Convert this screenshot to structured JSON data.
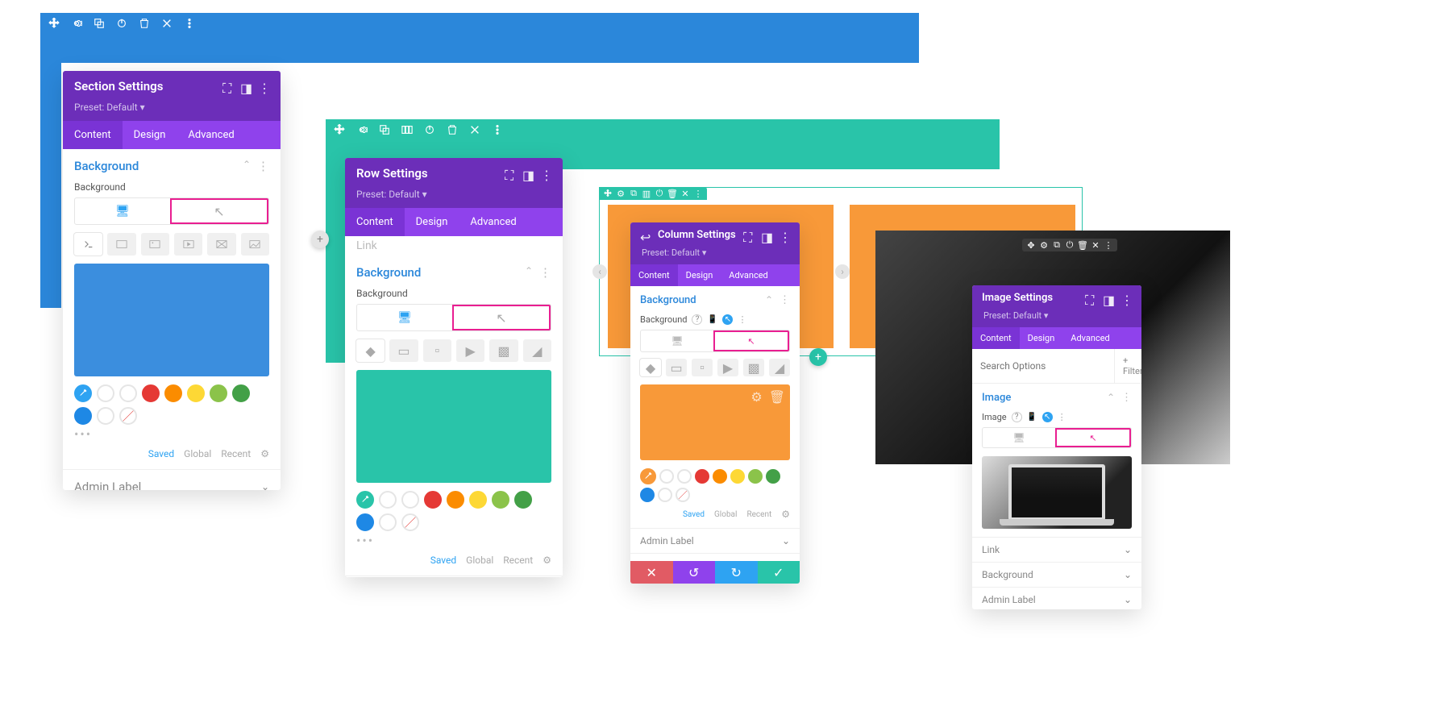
{
  "colors": {
    "blue": "#2b87da",
    "teal": "#29c4a9",
    "purple": "#6c2eb9",
    "purple_light": "#8f42ec",
    "orange": "#f89939",
    "red": "#e15b64",
    "linkblue": "#2ea3f2",
    "magenta": "#e91e91"
  },
  "modals": {
    "section": {
      "title": "Section Settings",
      "preset": "Preset: Default",
      "tabs": [
        "Content",
        "Design",
        "Advanced"
      ],
      "active_tab": "Content",
      "bg_title": "Background",
      "bg_label": "Background",
      "preview_color": "#3b8ede",
      "picker_ring": "#2ea3f2",
      "swatches": [
        "#ffffff",
        "#ffffff",
        "#e53935",
        "#fb8c00",
        "#fdd835",
        "#8bc34a",
        "#43a047",
        "#1e88e5",
        "#ffffff"
      ],
      "links": [
        "Saved",
        "Global",
        "Recent"
      ],
      "admin": "Admin Label"
    },
    "row": {
      "title": "Row Settings",
      "preset": "Preset: Default",
      "tabs": [
        "Content",
        "Design",
        "Advanced"
      ],
      "active_tab": "Content",
      "link_title": "Link",
      "bg_title": "Background",
      "bg_label": "Background",
      "preview_color": "#29c4a9",
      "picker_ring": "#29c4a9",
      "swatches": [
        "#ffffff",
        "#ffffff",
        "#e53935",
        "#fb8c00",
        "#fdd835",
        "#8bc34a",
        "#43a047",
        "#1e88e5",
        "#ffffff"
      ],
      "links": [
        "Saved",
        "Global",
        "Recent"
      ],
      "admin": "Admin Label"
    },
    "column": {
      "title": "Column Settings",
      "preset": "Preset: Default",
      "tabs": [
        "Content",
        "Design",
        "Advanced"
      ],
      "active_tab": "Content",
      "bg_title": "Background",
      "bg_label": "Background",
      "bg_help": "?",
      "preview_color": "#f89939",
      "picker_ring": "#f89939",
      "swatches": [
        "#ffffff",
        "#ffffff",
        "#e53935",
        "#fb8c00",
        "#fdd835",
        "#8bc34a",
        "#43a047",
        "#1e88e5",
        "#ffffff"
      ],
      "links": [
        "Saved",
        "Global",
        "Recent"
      ],
      "admin": "Admin Label"
    },
    "image": {
      "title": "Image Settings",
      "preset": "Preset: Default",
      "tabs": [
        "Content",
        "Design",
        "Advanced"
      ],
      "active_tab": "Content",
      "search_placeholder": "Search Options",
      "filter_label": "+ Filter",
      "img_title": "Image",
      "img_label": "Image",
      "img_help": "?",
      "link_title": "Link",
      "bg_title": "Background",
      "admin": "Admin Label"
    }
  }
}
